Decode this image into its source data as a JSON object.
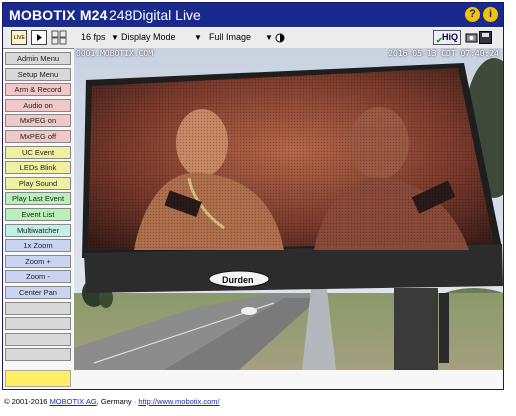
{
  "header": {
    "brand": "MOBOTIX M24",
    "camera_name": "248Digital Live",
    "help_icon_1": "?",
    "help_icon_2": "i"
  },
  "toolbar": {
    "live_label": "LIVE",
    "fps": "16 fps",
    "display_mode": "Display Mode",
    "image_mode": "Full Image",
    "hiq_label": "HiQ"
  },
  "sidebar": {
    "items": [
      {
        "label": "Admin Menu",
        "color": "#d8d8d8"
      },
      {
        "label": "Setup Menu",
        "color": "#d8d8d8"
      },
      {
        "label": "Arm & Record",
        "color": "#f0c8c8"
      },
      {
        "label": "Audio on",
        "color": "#f0c8c8"
      },
      {
        "label": "MxPEG on",
        "color": "#f0c8c8"
      },
      {
        "label": "MxPEG off",
        "color": "#f0c8c8"
      },
      {
        "label": "UC Event",
        "color": "#f0f0a0"
      },
      {
        "label": "LEDs Blink",
        "color": "#f0f0a0"
      },
      {
        "label": "Play Sound",
        "color": "#f0f0a0"
      },
      {
        "label": "Play Last Event",
        "color": "#b8f0b8"
      },
      {
        "label": "Event List",
        "color": "#b8f0b8"
      },
      {
        "label": "Multiwatcher",
        "color": "#c0f0e8"
      },
      {
        "label": "1x Zoom",
        "color": "#c8d4f0"
      },
      {
        "label": "Zoom +",
        "color": "#c8d4f0"
      },
      {
        "label": "Zoom -",
        "color": "#c8d4f0"
      },
      {
        "label": "Center Pan",
        "color": "#c8d4f0"
      },
      {
        "label": "",
        "color": "#d8d8d8"
      },
      {
        "label": "",
        "color": "#d8d8d8"
      },
      {
        "label": "",
        "color": "#d8d8d8"
      },
      {
        "label": "",
        "color": "#d8d8d8"
      }
    ]
  },
  "image": {
    "overlay_source": "0001.MOBOTIX.COM",
    "overlay_timestamp": "2016-05-13 CDT 07:40:24",
    "billboard_brand": "Durden"
  },
  "footer": {
    "copyright": "© 2001-2016 ",
    "company_link": "MOBOTIX AG",
    "country": ", Germany · ",
    "site_link": "http://www.mobotix.com/"
  }
}
